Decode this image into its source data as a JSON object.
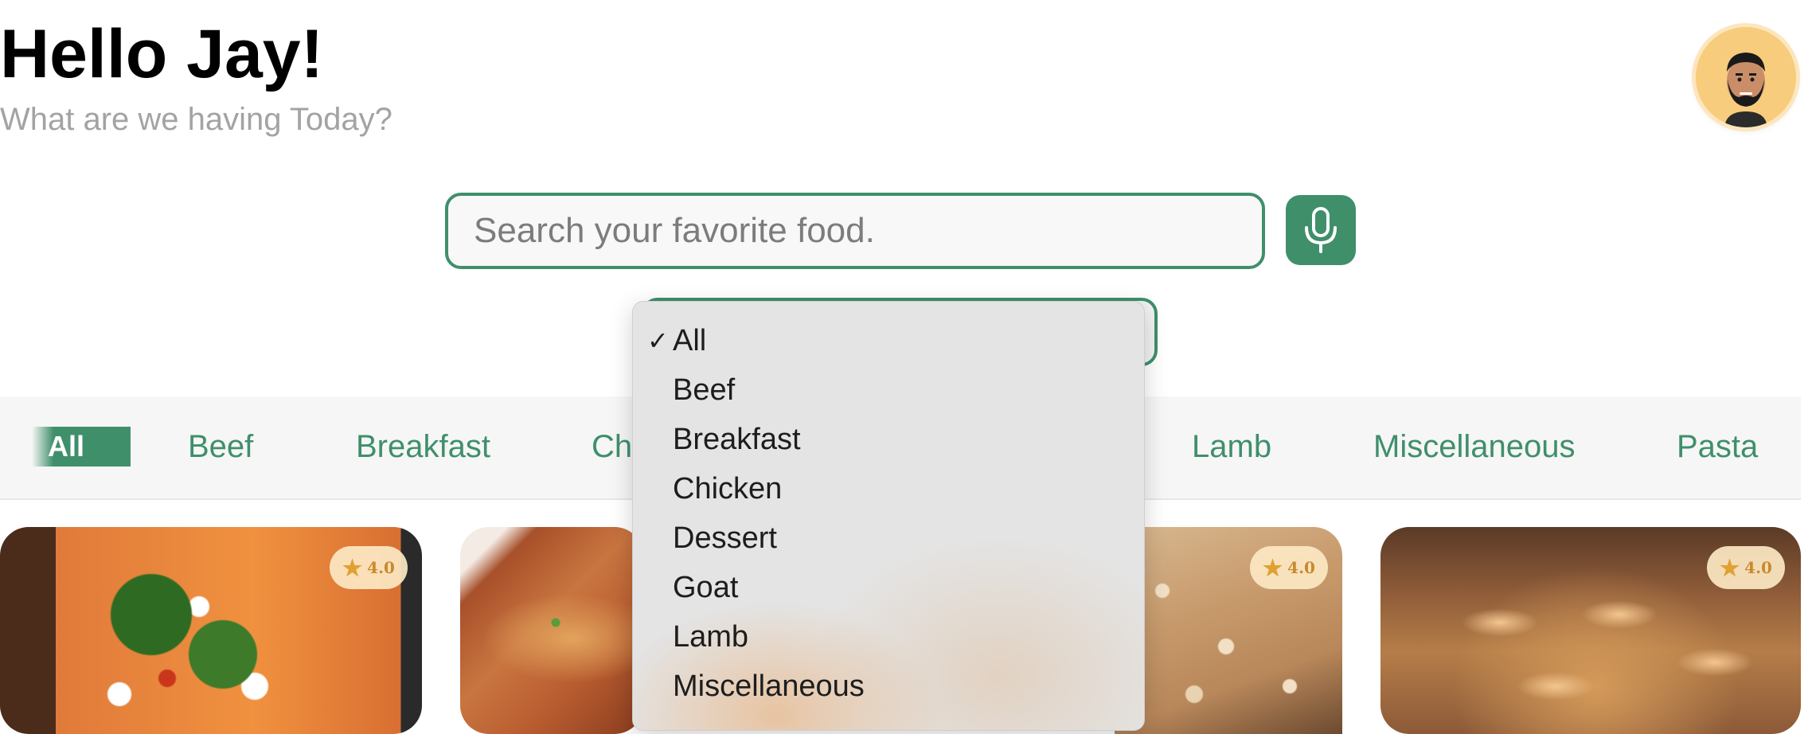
{
  "header": {
    "title": "Hello Jay!",
    "subtitle": "What are we having Today?"
  },
  "avatar": {
    "icon": "person-avatar-icon"
  },
  "search": {
    "placeholder": "Search your favorite food.",
    "value": "",
    "mic_icon": "microphone-icon"
  },
  "category_select": {
    "selected": "All",
    "options": [
      "All",
      "Beef",
      "Breakfast",
      "Chicken",
      "Dessert",
      "Goat",
      "Lamb",
      "Miscellaneous"
    ]
  },
  "category_tabs": {
    "active": "All",
    "items": [
      "All",
      "Beef",
      "Breakfast",
      "Ch",
      "Lamb",
      "Miscellaneous",
      "Pasta"
    ]
  },
  "cards": [
    {
      "rating": "4.0"
    },
    {
      "rating": ""
    },
    {
      "rating": "4.0"
    },
    {
      "rating": "4.0"
    }
  ],
  "colors": {
    "accent": "#3f8f6b",
    "rating_bg": "#fce8c3",
    "rating_text": "#c98a2d",
    "subtitle": "#a3a3a3"
  }
}
